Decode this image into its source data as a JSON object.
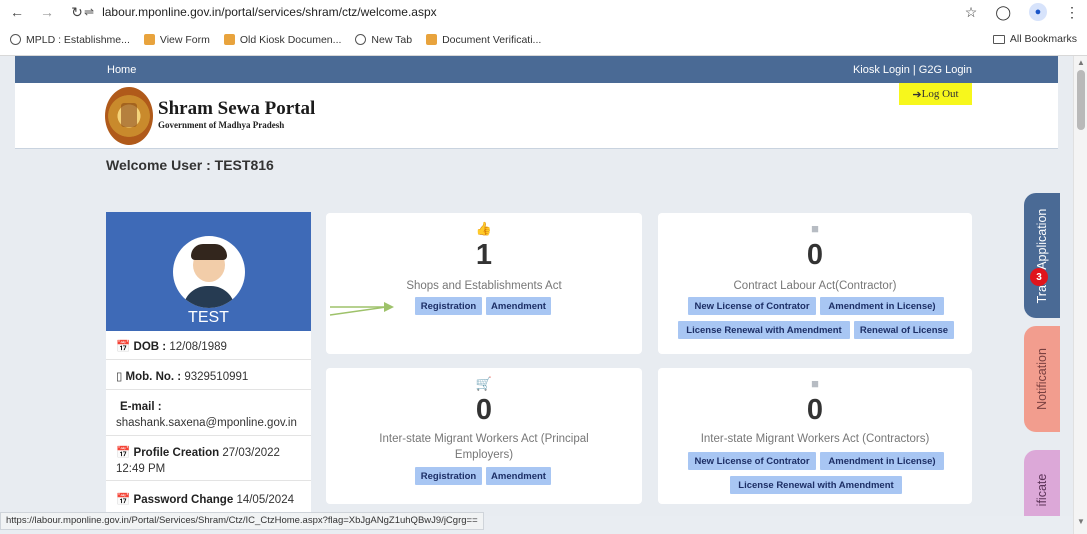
{
  "browser": {
    "url": "labour.mponline.gov.in/portal/services/shram/ctz/welcome.aspx",
    "bookmarks": [
      "MPLD : Establishme...",
      "View Form",
      "Old Kiosk Documen...",
      "New Tab",
      "Document Verificati..."
    ],
    "all_bookmarks": "All Bookmarks",
    "status_url": "https://labour.mponline.gov.in/Portal/Services/Shram/Ctz/IC_CtzHome.aspx?flag=XbJgANgZ1uhQBwJ9/jCgrg=="
  },
  "topnav": {
    "home": "Home",
    "login_links": "Kiosk Login | G2G Login"
  },
  "header": {
    "title": "Shram Sewa Portal",
    "subtitle": "Government of Madhya Pradesh",
    "logout": "Log Out"
  },
  "welcome": "Welcome User : TEST816",
  "profile": {
    "name": "TEST",
    "dob_label": "DOB :",
    "dob": "12/08/1989",
    "mobile_label": "Mob. No. :",
    "mobile": "9329510991",
    "email_label": "E-mail :",
    "email": "shashank.saxena@mponline.gov.in",
    "creation_label": "Profile Creation",
    "creation_date": "27/03/2022",
    "creation_time": "12:49 PM",
    "password_label": "Password Change",
    "password_date": "14/05/2024"
  },
  "cards": {
    "shops": {
      "count": "1",
      "title": "Shops and Establishments Act",
      "buttons": [
        "Registration",
        "Amendment"
      ]
    },
    "contract": {
      "count": "0",
      "title": "Contract Labour Act(Contractor)",
      "buttons": [
        "New License of Contrator",
        "Amendment in License)",
        "License Renewal with Amendment",
        "Renewal of License"
      ]
    },
    "migrant_principal": {
      "count": "0",
      "title_line1": "Inter-state Migrant Workers Act (Principal",
      "title_line2": "Employers)",
      "buttons": [
        "Registration",
        "Amendment"
      ]
    },
    "migrant_contractors": {
      "count": "0",
      "title": "Inter-state Migrant Workers Act (Contractors)",
      "buttons": [
        "New License of Contrator",
        "Amendment in License)",
        "License Renewal with Amendment"
      ]
    }
  },
  "side_tabs": {
    "track": "Track Application",
    "notification": "Notification",
    "notification_count": "3",
    "certificate": "ificate"
  },
  "colors": {
    "nav": "#4a6a95",
    "profile_top": "#3e6ab7",
    "button": "#a8c6f3",
    "logout": "#f7f71c",
    "track": "#4a6a95",
    "notification": "#f29d8e",
    "certificate": "#dca8d8",
    "badge": "#e0141c"
  }
}
